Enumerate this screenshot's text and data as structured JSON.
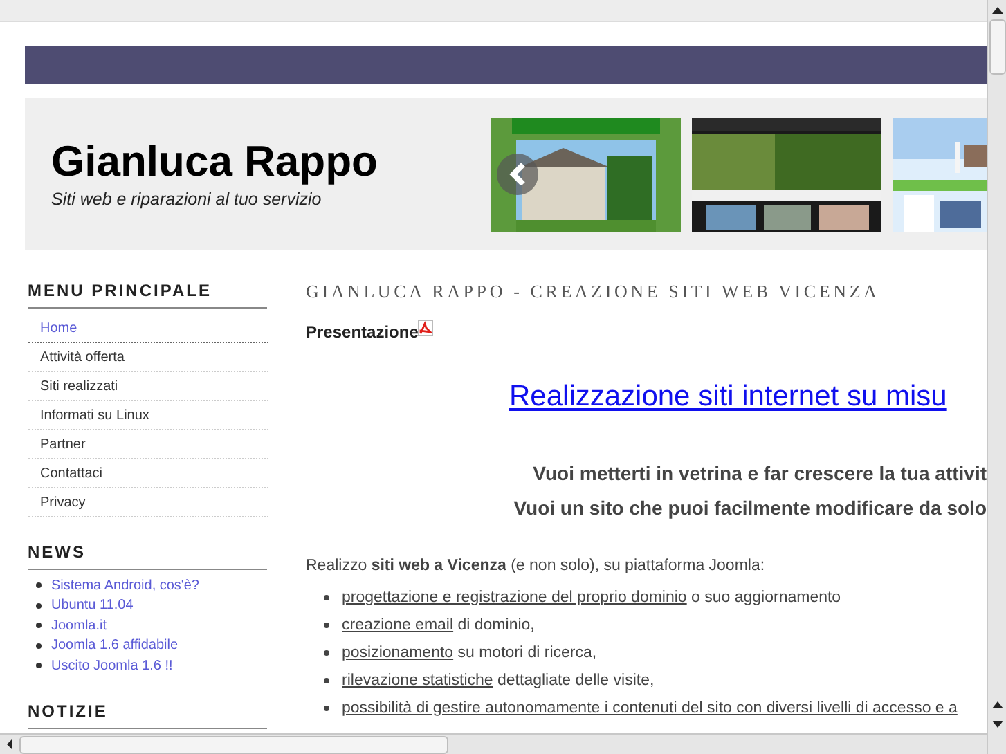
{
  "header": {
    "title": "Gianluca Rappo",
    "tagline": "Siti web e riparazioni al tuo servizio"
  },
  "sidebar": [
    {
      "title": "MENU PRINCIPALE",
      "kind": "menu",
      "items": [
        {
          "label": "Home",
          "selected": true
        },
        {
          "label": "Attività offerta",
          "selected": false
        },
        {
          "label": "Siti realizzati",
          "selected": false
        },
        {
          "label": "Informati su Linux",
          "selected": false
        },
        {
          "label": "Partner",
          "selected": false
        },
        {
          "label": "Contattaci",
          "selected": false
        },
        {
          "label": "Privacy",
          "selected": false
        }
      ]
    },
    {
      "title": "NEWS",
      "kind": "bullets",
      "items": [
        {
          "label": "Sistema Android, cos'è?"
        },
        {
          "label": "Ubuntu 11.04"
        },
        {
          "label": "Joomla.it"
        },
        {
          "label": "Joomla 1.6 affidabile"
        },
        {
          "label": "Uscito Joomla 1.6 !!"
        }
      ]
    },
    {
      "title": "NOTIZIE",
      "kind": "heading"
    }
  ],
  "content": {
    "page_title": "GIANLUCA RAPPO - CREAZIONE SITI WEB VICENZA",
    "section": "Presentazione",
    "headline": "Realizzazione siti internet su misu",
    "questions": [
      "Vuoi metterti in vetrina e far crescere la tua attivit",
      "Vuoi un sito che puoi facilmente modificare da solo"
    ],
    "intro": "Realizzo **siti web a Vicenza** (e non solo), su piattaforma Joomla:",
    "bullets": [
      {
        "link": "progettazione e registrazione del proprio dominio",
        "rest": " o suo aggiornamento"
      },
      {
        "link": "creazione email",
        "rest": " di dominio,"
      },
      {
        "link": "posizionamento",
        "rest": " su motori di ricerca,"
      },
      {
        "link": "rilevazione statistiche",
        "rest": " dettagliate delle visite,"
      },
      {
        "link": "possibilità di gestire autonomamente i contenuti del sito con diversi livelli di accesso e a"
      }
    ]
  }
}
